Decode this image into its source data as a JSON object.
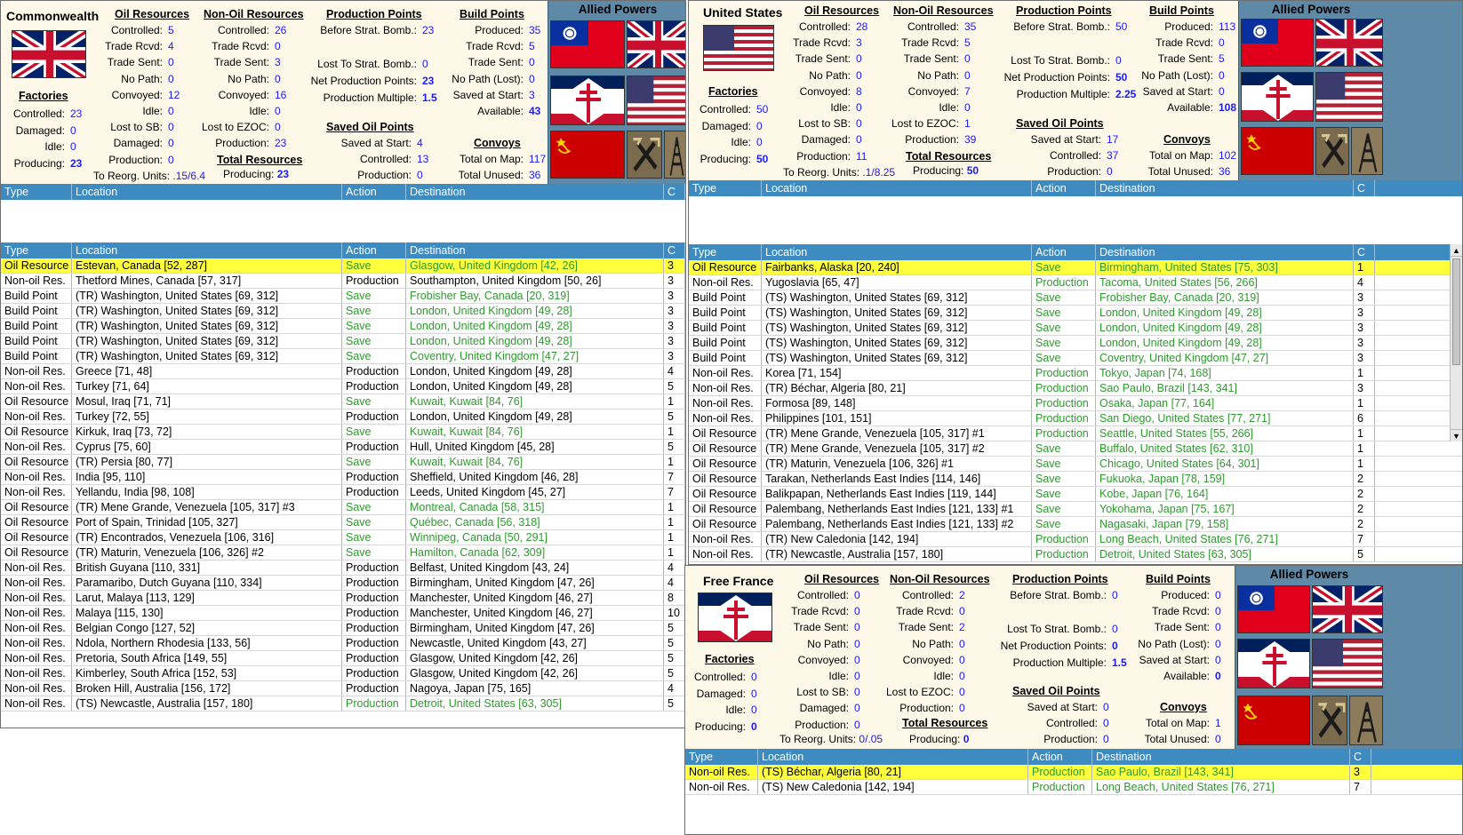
{
  "commonwealth": {
    "name": "Commonwealth",
    "oil": {
      "title": "Oil Resources",
      "rows": [
        [
          "Controlled:",
          "5"
        ],
        [
          "Trade Rcvd:",
          "4"
        ],
        [
          "Trade Sent:",
          "0"
        ],
        [
          "No Path:",
          "0"
        ],
        [
          "Convoyed:",
          "12"
        ],
        [
          "Idle:",
          "0"
        ],
        [
          "Lost to SB:",
          "0"
        ],
        [
          "Damaged:",
          "0"
        ],
        [
          "Production:",
          "0"
        ]
      ]
    },
    "nonoil": {
      "title": "Non-Oil Resources",
      "rows": [
        [
          "Controlled:",
          "26"
        ],
        [
          "Trade Rcvd:",
          "0"
        ],
        [
          "Trade Sent:",
          "3"
        ],
        [
          "No Path:",
          "0"
        ],
        [
          "Convoyed:",
          "16"
        ],
        [
          "Idle:",
          "0"
        ],
        [
          "Lost to EZOC:",
          "0"
        ],
        [
          "Production:",
          "23"
        ]
      ]
    },
    "total": {
      "title": "Total Resources",
      "label": "Producing:",
      "value": "23"
    },
    "reorg": {
      "label": "To Reorg. Units:",
      "value": ".15/6.4"
    },
    "pp": {
      "title": "Production Points",
      "before": [
        "Before Strat. Bomb.:",
        "23"
      ],
      "lost": [
        "Lost To Strat. Bomb.:",
        "0"
      ],
      "net": [
        "Net Production Points:",
        "23"
      ],
      "mult": [
        "Production Multiple:",
        "1.5"
      ]
    },
    "saved": {
      "title": "Saved Oil Points",
      "rows": [
        [
          "Saved at Start:",
          "4"
        ],
        [
          "Controlled:",
          "13"
        ],
        [
          "Production:",
          "0"
        ]
      ]
    },
    "bp": {
      "title": "Build Points",
      "rows": [
        [
          "Produced:",
          "35"
        ],
        [
          "Trade Rcvd:",
          "5"
        ],
        [
          "Trade Sent:",
          "0"
        ],
        [
          "No Path (Lost):",
          "0"
        ],
        [
          "Saved at Start:",
          "3"
        ],
        [
          "Available:",
          "43"
        ]
      ]
    },
    "convoys": {
      "title": "Convoys",
      "rows": [
        [
          "Total on Map:",
          "117"
        ],
        [
          "Total Unused:",
          "36"
        ]
      ]
    },
    "factories": {
      "title": "Factories",
      "rows": [
        [
          "Controlled:",
          "23"
        ],
        [
          "Damaged:",
          "0"
        ],
        [
          "Idle:",
          "0"
        ],
        [
          "Producing:",
          "23"
        ]
      ]
    },
    "allied_title": "Allied Powers"
  },
  "usa": {
    "name": "United States",
    "oil": {
      "title": "Oil Resources",
      "rows": [
        [
          "Controlled:",
          "28"
        ],
        [
          "Trade Rcvd:",
          "3"
        ],
        [
          "Trade Sent:",
          "0"
        ],
        [
          "No Path:",
          "0"
        ],
        [
          "Convoyed:",
          "8"
        ],
        [
          "Idle:",
          "0"
        ],
        [
          "Lost to SB:",
          "0"
        ],
        [
          "Damaged:",
          "0"
        ],
        [
          "Production:",
          "11"
        ]
      ]
    },
    "nonoil": {
      "title": "Non-Oil Resources",
      "rows": [
        [
          "Controlled:",
          "35"
        ],
        [
          "Trade Rcvd:",
          "5"
        ],
        [
          "Trade Sent:",
          "0"
        ],
        [
          "No Path:",
          "0"
        ],
        [
          "Convoyed:",
          "7"
        ],
        [
          "Idle:",
          "0"
        ],
        [
          "Lost to EZOC:",
          "1"
        ],
        [
          "Production:",
          "39"
        ]
      ]
    },
    "total": {
      "title": "Total Resources",
      "label": "Producing:",
      "value": "50"
    },
    "reorg": {
      "label": "To Reorg. Units:",
      "value": ".1/8.25"
    },
    "pp": {
      "title": "Production Points",
      "before": [
        "Before Strat. Bomb.:",
        "50"
      ],
      "lost": [
        "Lost To Strat. Bomb.:",
        "0"
      ],
      "net": [
        "Net Production Points:",
        "50"
      ],
      "mult": [
        "Production Multiple:",
        "2.25"
      ]
    },
    "saved": {
      "title": "Saved Oil Points",
      "rows": [
        [
          "Saved at Start:",
          "17"
        ],
        [
          "Controlled:",
          "37"
        ],
        [
          "Production:",
          "0"
        ]
      ]
    },
    "bp": {
      "title": "Build Points",
      "rows": [
        [
          "Produced:",
          "113"
        ],
        [
          "Trade Rcvd:",
          "0"
        ],
        [
          "Trade Sent:",
          "5"
        ],
        [
          "No Path (Lost):",
          "0"
        ],
        [
          "Saved at Start:",
          "0"
        ],
        [
          "Available:",
          "108"
        ]
      ]
    },
    "convoys": {
      "title": "Convoys",
      "rows": [
        [
          "Total on Map:",
          "102"
        ],
        [
          "Total Unused:",
          "36"
        ]
      ]
    },
    "factories": {
      "title": "Factories",
      "rows": [
        [
          "Controlled:",
          "50"
        ],
        [
          "Damaged:",
          "0"
        ],
        [
          "Idle:",
          "0"
        ],
        [
          "Producing:",
          "50"
        ]
      ]
    },
    "allied_title": "Allied Powers"
  },
  "france": {
    "name": "Free France",
    "oil": {
      "title": "Oil Resources",
      "rows": [
        [
          "Controlled:",
          "0"
        ],
        [
          "Trade Rcvd:",
          "0"
        ],
        [
          "Trade Sent:",
          "0"
        ],
        [
          "No Path:",
          "0"
        ],
        [
          "Convoyed:",
          "0"
        ],
        [
          "Idle:",
          "0"
        ],
        [
          "Lost to SB:",
          "0"
        ],
        [
          "Damaged:",
          "0"
        ],
        [
          "Production:",
          "0"
        ]
      ]
    },
    "nonoil": {
      "title": "Non-Oil Resources",
      "rows": [
        [
          "Controlled:",
          "2"
        ],
        [
          "Trade Rcvd:",
          "0"
        ],
        [
          "Trade Sent:",
          "2"
        ],
        [
          "No Path:",
          "0"
        ],
        [
          "Convoyed:",
          "0"
        ],
        [
          "Idle:",
          "0"
        ],
        [
          "Lost to EZOC:",
          "0"
        ],
        [
          "Production:",
          "0"
        ]
      ]
    },
    "total": {
      "title": "Total Resources",
      "label": "Producing:",
      "value": "0"
    },
    "reorg": {
      "label": "To Reorg. Units:",
      "value": "0/.05"
    },
    "pp": {
      "title": "Production Points",
      "before": [
        "Before Strat. Bomb.:",
        "0"
      ],
      "lost": [
        "Lost To Strat. Bomb.:",
        "0"
      ],
      "net": [
        "Net Production Points:",
        "0"
      ],
      "mult": [
        "Production Multiple:",
        "1.5"
      ]
    },
    "saved": {
      "title": "Saved Oil Points",
      "rows": [
        [
          "Saved at Start:",
          "0"
        ],
        [
          "Controlled:",
          "0"
        ],
        [
          "Production:",
          "0"
        ]
      ]
    },
    "bp": {
      "title": "Build Points",
      "rows": [
        [
          "Produced:",
          "0"
        ],
        [
          "Trade Rcvd:",
          "0"
        ],
        [
          "Trade Sent:",
          "0"
        ],
        [
          "No Path (Lost):",
          "0"
        ],
        [
          "Saved at Start:",
          "0"
        ],
        [
          "Available:",
          "0"
        ]
      ]
    },
    "convoys": {
      "title": "Convoys",
      "rows": [
        [
          "Total on Map:",
          "1"
        ],
        [
          "Total Unused:",
          "0"
        ]
      ]
    },
    "factories": {
      "title": "Factories",
      "rows": [
        [
          "Controlled:",
          "0"
        ],
        [
          "Damaged:",
          "0"
        ],
        [
          "Idle:",
          "0"
        ],
        [
          "Producing:",
          "0"
        ]
      ]
    },
    "allied_title": "Allied Powers"
  },
  "columns": [
    "Type",
    "Location",
    "Action",
    "Destination",
    "C"
  ],
  "cw_rows": [
    [
      "Oil Resource",
      "Estevan, Canada [52, 287]",
      "Save",
      "Glasgow, United Kingdom [42, 26]",
      "3",
      1
    ],
    [
      "Non-oil Res.",
      "Thetford Mines, Canada [57, 317]",
      "Production",
      "Southampton, United Kingdom [50, 26]",
      "3",
      0
    ],
    [
      "Build Point",
      "(TR) Washington, United States [69, 312]",
      "Save",
      "Frobisher Bay, Canada [20, 319]",
      "3",
      0
    ],
    [
      "Build Point",
      "(TR) Washington, United States [69, 312]",
      "Save",
      "London, United Kingdom [49, 28]",
      "3",
      0
    ],
    [
      "Build Point",
      "(TR) Washington, United States [69, 312]",
      "Save",
      "London, United Kingdom [49, 28]",
      "3",
      0
    ],
    [
      "Build Point",
      "(TR) Washington, United States [69, 312]",
      "Save",
      "London, United Kingdom [49, 28]",
      "3",
      0
    ],
    [
      "Build Point",
      "(TR) Washington, United States [69, 312]",
      "Save",
      "Coventry, United Kingdom [47, 27]",
      "3",
      0
    ],
    [
      "Non-oil Res.",
      "Greece [71, 48]",
      "Production",
      "London, United Kingdom [49, 28]",
      "4",
      0
    ],
    [
      "Non-oil Res.",
      "Turkey [71, 64]",
      "Production",
      "London, United Kingdom [49, 28]",
      "5",
      0
    ],
    [
      "Oil Resource",
      "Mosul, Iraq [71, 71]",
      "Save",
      "Kuwait, Kuwait [84, 76]",
      "1",
      0
    ],
    [
      "Non-oil Res.",
      "Turkey [72, 55]",
      "Production",
      "London, United Kingdom [49, 28]",
      "5",
      0
    ],
    [
      "Oil Resource",
      "Kirkuk, Iraq [73, 72]",
      "Save",
      "Kuwait, Kuwait [84, 76]",
      "1",
      0
    ],
    [
      "Non-oil Res.",
      "Cyprus [75, 60]",
      "Production",
      "Hull, United Kingdom [45, 28]",
      "5",
      0
    ],
    [
      "Oil Resource",
      "(TR) Persia [80, 77]",
      "Save",
      "Kuwait, Kuwait [84, 76]",
      "1",
      0
    ],
    [
      "Non-oil Res.",
      "India [95, 110]",
      "Production",
      "Sheffield, United Kingdom [46, 28]",
      "7",
      0
    ],
    [
      "Non-oil Res.",
      "Yellandu, India [98, 108]",
      "Production",
      "Leeds, United Kingdom [45, 27]",
      "7",
      0
    ],
    [
      "Oil Resource",
      "(TR) Mene Grande, Venezuela [105, 317] #3",
      "Save",
      "Montreal, Canada [58, 315]",
      "1",
      0
    ],
    [
      "Oil Resource",
      "Port of Spain, Trinidad [105, 327]",
      "Save",
      "Québec, Canada [56, 318]",
      "1",
      0
    ],
    [
      "Oil Resource",
      "(TR) Encontrados, Venezuela [106, 316]",
      "Save",
      "Winnipeg, Canada [50, 291]",
      "1",
      0
    ],
    [
      "Oil Resource",
      "(TR) Maturin, Venezuela [106, 326] #2",
      "Save",
      "Hamilton, Canada [62, 309]",
      "1",
      0
    ],
    [
      "Non-oil Res.",
      "British Guyana [110, 331]",
      "Production",
      "Belfast, United Kingdom [43, 24]",
      "4",
      0
    ],
    [
      "Non-oil Res.",
      "Paramaribo, Dutch Guyana [110, 334]",
      "Production",
      "Birmingham, United Kingdom [47, 26]",
      "4",
      0
    ],
    [
      "Non-oil Res.",
      "Larut, Malaya [113, 129]",
      "Production",
      "Manchester, United Kingdom [46, 27]",
      "8",
      0
    ],
    [
      "Non-oil Res.",
      "Malaya [115, 130]",
      "Production",
      "Manchester, United Kingdom [46, 27]",
      "10",
      0
    ],
    [
      "Non-oil Res.",
      "Belgian Congo [127, 52]",
      "Production",
      "Birmingham, United Kingdom [47, 26]",
      "5",
      0
    ],
    [
      "Non-oil Res.",
      "Ndola, Northern Rhodesia [133, 56]",
      "Production",
      "Newcastle, United Kingdom [43, 27]",
      "5",
      0
    ],
    [
      "Non-oil Res.",
      "Pretoria, South Africa [149, 55]",
      "Production",
      "Glasgow, United Kingdom [42, 26]",
      "5",
      0
    ],
    [
      "Non-oil Res.",
      "Kimberley, South Africa [152, 53]",
      "Production",
      "Glasgow, United Kingdom [42, 26]",
      "5",
      0
    ],
    [
      "Non-oil Res.",
      "Broken Hill, Australia [156, 172]",
      "Production",
      "Nagoya, Japan [75, 165]",
      "4",
      0
    ],
    [
      "Non-oil Res.",
      "(TS) Newcastle, Australia [157, 180]",
      "Production",
      "Detroit, United States [63, 305]",
      "5",
      0
    ]
  ],
  "us_rows": [
    [
      "Oil Resource",
      "Fairbanks, Alaska [20, 240]",
      "Save",
      "Birmingham, United States [75, 303]",
      "1",
      1
    ],
    [
      "Non-oil Res.",
      "Yugoslavia [65, 47]",
      "Production",
      "Tacoma, United States [56, 266]",
      "4",
      0
    ],
    [
      "Build Point",
      "(TS) Washington, United States [69, 312]",
      "Save",
      "Frobisher Bay, Canada [20, 319]",
      "3",
      0
    ],
    [
      "Build Point",
      "(TS) Washington, United States [69, 312]",
      "Save",
      "London, United Kingdom [49, 28]",
      "3",
      0
    ],
    [
      "Build Point",
      "(TS) Washington, United States [69, 312]",
      "Save",
      "London, United Kingdom [49, 28]",
      "3",
      0
    ],
    [
      "Build Point",
      "(TS) Washington, United States [69, 312]",
      "Save",
      "London, United Kingdom [49, 28]",
      "3",
      0
    ],
    [
      "Build Point",
      "(TS) Washington, United States [69, 312]",
      "Save",
      "Coventry, United Kingdom [47, 27]",
      "3",
      0
    ],
    [
      "Non-oil Res.",
      "Korea [71, 154]",
      "Production",
      "Tokyo, Japan [74, 168]",
      "1",
      0
    ],
    [
      "Non-oil Res.",
      "(TR) Béchar, Algeria [80, 21]",
      "Production",
      "Sao Paulo, Brazil [143, 341]",
      "3",
      0
    ],
    [
      "Non-oil Res.",
      "Formosa [89, 148]",
      "Production",
      "Osaka, Japan [77, 164]",
      "1",
      0
    ],
    [
      "Non-oil Res.",
      "Philippines [101, 151]",
      "Production",
      "San Diego, United States [77, 271]",
      "6",
      0
    ],
    [
      "Oil Resource",
      "(TR) Mene Grande, Venezuela [105, 317] #1",
      "Production",
      "Seattle, United States [55, 266]",
      "1",
      0
    ],
    [
      "Oil Resource",
      "(TR) Mene Grande, Venezuela [105, 317] #2",
      "Save",
      "Buffalo, United States [62, 310]",
      "1",
      0
    ],
    [
      "Oil Resource",
      "(TR) Maturin, Venezuela [106, 326] #1",
      "Save",
      "Chicago, United States [64, 301]",
      "1",
      0
    ],
    [
      "Oil Resource",
      "Tarakan, Netherlands East Indies [114, 146]",
      "Save",
      "Fukuoka, Japan [78, 159]",
      "2",
      0
    ],
    [
      "Oil Resource",
      "Balikpapan, Netherlands East Indies [119, 144]",
      "Save",
      "Kobe, Japan [76, 164]",
      "2",
      0
    ],
    [
      "Oil Resource",
      "Palembang, Netherlands East Indies [121, 133] #1",
      "Save",
      "Yokohama, Japan [75, 167]",
      "2",
      0
    ],
    [
      "Oil Resource",
      "Palembang, Netherlands East Indies [121, 133] #2",
      "Save",
      "Nagasaki, Japan [79, 158]",
      "2",
      0
    ],
    [
      "Non-oil Res.",
      "(TR) New Caledonia [142, 194]",
      "Production",
      "Long Beach, United States [76, 271]",
      "7",
      0
    ],
    [
      "Non-oil Res.",
      "(TR) Newcastle, Australia [157, 180]",
      "Production",
      "Detroit, United States [63, 305]",
      "5",
      0
    ]
  ],
  "ff_rows": [
    [
      "Non-oil Res.",
      "(TS) Béchar, Algeria [80, 21]",
      "Production",
      "Sao Paulo, Brazil [143, 341]",
      "3",
      1
    ],
    [
      "Non-oil Res.",
      "(TS) New Caledonia [142, 194]",
      "Production",
      "Long Beach, United States [76, 271]",
      "7",
      0
    ]
  ],
  "colors": {
    "header_blue": "#3e8bc2",
    "highlight": "#ffff3b",
    "green_text": "#2e9b2e",
    "value_blue": "#1a1aff",
    "allied_bg": "#5e8aa8"
  }
}
